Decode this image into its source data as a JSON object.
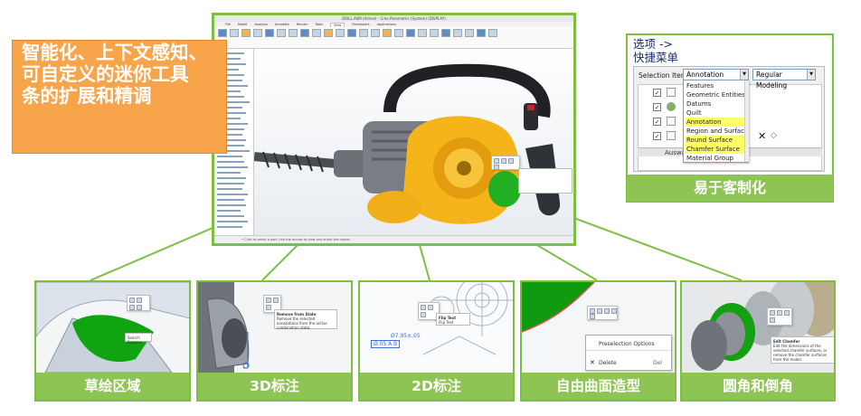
{
  "headline": {
    "lines": [
      "智能化、上下文感知、",
      "可自定义的迷你工具",
      "条的扩展和精调"
    ]
  },
  "cad_window": {
    "title": "DRILL.ASM (Active) - Creo Parametric (System) (DISPLAY)",
    "tabs": [
      "File",
      "Model",
      "Analysis",
      "Annotate",
      "Render",
      "Tools",
      "View",
      "Framework",
      "Applications"
    ],
    "active_tab": "View",
    "status_text": "• Click to select a part. Use the mouse to view and orient the model."
  },
  "customization": {
    "title_line1": "选项 ->",
    "title_line2": "快捷菜单",
    "selection_label": "Selection Item:",
    "selection_value": "Annotation",
    "mode_value": "Regular Modeling",
    "list_items": [
      {
        "label": "Features",
        "highlight": false
      },
      {
        "label": "Geometric Entities",
        "highlight": false
      },
      {
        "label": "Datums",
        "highlight": false
      },
      {
        "label": "Quilt",
        "highlight": false
      },
      {
        "label": "Annotation",
        "highlight": true
      },
      {
        "label": "Region and Surface",
        "highlight": false
      },
      {
        "label": "Round Surface",
        "highlight": true
      },
      {
        "label": "Chamfer Surface",
        "highlight": true
      },
      {
        "label": "Material Group",
        "highlight": false
      }
    ],
    "partial_row": "Auswa",
    "caption": "易于客制化"
  },
  "thumbnails": [
    {
      "caption": "草绘区域",
      "tip": "Search Regions"
    },
    {
      "caption": "3D标注",
      "tip_title": "Remove from State",
      "tip_body": "Remove the selected annotations from the active combination state."
    },
    {
      "caption": "2D标注",
      "tip_title": "Flip Text",
      "tip_body": "Flip Text",
      "dim": "Ø7.95±.05",
      "gdt": "Ø.05 A B"
    },
    {
      "caption": "自由曲面造型",
      "menu_1": "Preselection Options",
      "menu_2": "Delete",
      "menu_3": "Del"
    },
    {
      "caption": "圆角和倒角",
      "tip_title": "Edit Chamfer",
      "tip_body": "Edit the dimensions of the selected chamfer surfaces, or remove the chamfer surfaces from the model."
    }
  ],
  "colors": {
    "accent_green": "#7ac143",
    "caption_green": "#8dc453",
    "headline_orange": "#f7a44a",
    "title_navy": "#1a2d6b",
    "list_highlight": "#ffff66"
  }
}
